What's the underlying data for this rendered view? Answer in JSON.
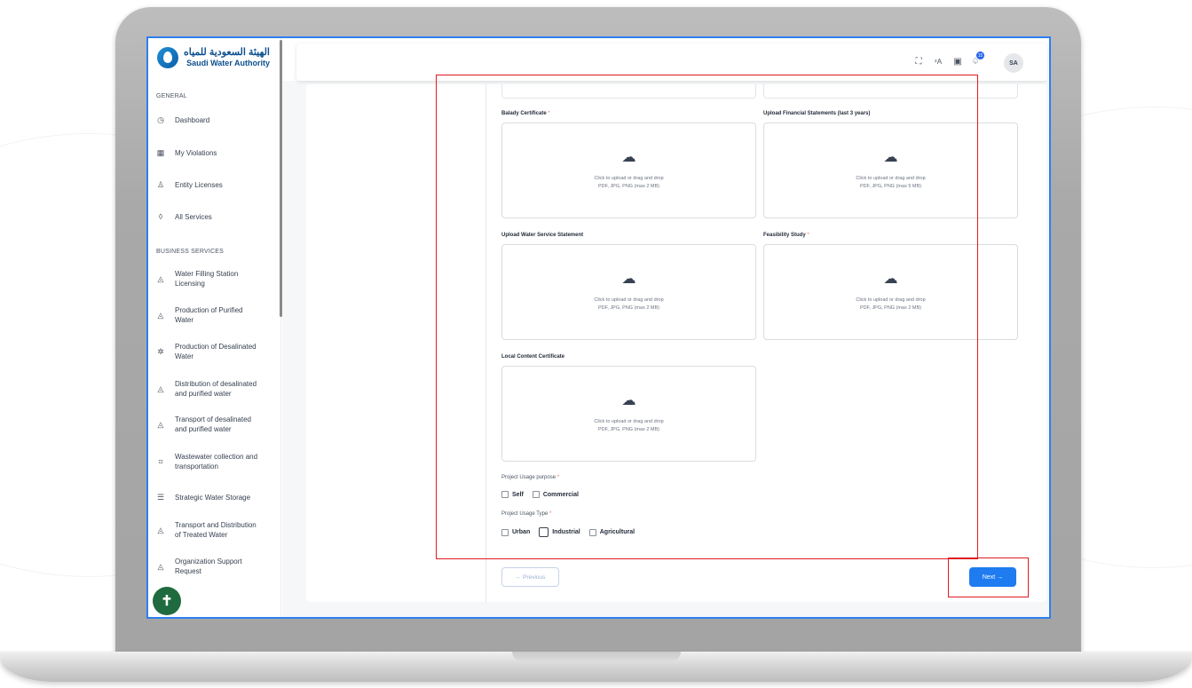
{
  "brand": {
    "arabic": "الهيئة السعودية للمياه",
    "english": "Saudi Water Authority"
  },
  "sidebar": {
    "general_label": "GENERAL",
    "general_items": [
      {
        "label": "Dashboard",
        "icon": "gauge-icon"
      },
      {
        "label": "My Violations",
        "icon": "grid-icon"
      },
      {
        "label": "Entity Licenses",
        "icon": "user-icon"
      },
      {
        "label": "All Services",
        "icon": "drop-icon"
      }
    ],
    "business_label": "BUSINESS SERVICES",
    "business_items": [
      {
        "line1": "Water Filling Station",
        "line2": "Licensing"
      },
      {
        "line1": "Production of Purified",
        "line2": "Water"
      },
      {
        "line1": "Production of Desalinated",
        "line2": "Water"
      },
      {
        "line1": "Distribution of desalinated",
        "line2": "and purified water"
      },
      {
        "line1": "Transport of desalinated",
        "line2": "and purified water"
      },
      {
        "line1": "Wastewater collection and",
        "line2": "transportation"
      },
      {
        "line1": "Strategic Water Storage",
        "line2": ""
      },
      {
        "line1": "Transport and Distribution",
        "line2": "of Treated Water"
      },
      {
        "line1": "Organization Support",
        "line2": "Request"
      }
    ],
    "accessibility_icon": "accessibility-icon"
  },
  "topbar": {
    "icons": [
      "fullscreen-icon",
      "translate-icon",
      "clipboard-icon",
      "bell-icon"
    ],
    "notification_count": "15",
    "avatar_initials": "SA"
  },
  "form": {
    "upload_hint": "Click to upload or drag and drop",
    "fields": [
      {
        "label": "Balady Certificate",
        "required": true,
        "formats": "PDF, JPG, PNG (max 2 MB)"
      },
      {
        "label": "Upload Financial Statements (last 3 years)",
        "required": false,
        "formats": "PDF, JPG, PNG (max 5 MB)"
      },
      {
        "label": "Upload Water Service Statement",
        "required": false,
        "formats": "PDF, JPG, PNG (max 2 MB)"
      },
      {
        "label": "Feasibility Study",
        "required": true,
        "formats": "PDF, JPG, PNG (max 2 MB)"
      },
      {
        "label": "Local Content Certificate",
        "required": false,
        "formats": "PDF, JPG, PNG (max 2 MB)"
      }
    ],
    "usage_purpose": {
      "label": "Project Usage purpose",
      "options": [
        "Self",
        "Commercial"
      ]
    },
    "usage_type": {
      "label": "Project Usage Type",
      "options": [
        "Urban",
        "Industrial",
        "Agricultural"
      ]
    },
    "required_mark": "*",
    "previous_label": "Previous",
    "next_label": "Next"
  },
  "colors": {
    "accent": "#1e7bf0",
    "highlight": "#e0191f",
    "accessibility": "#1f6b3f"
  }
}
